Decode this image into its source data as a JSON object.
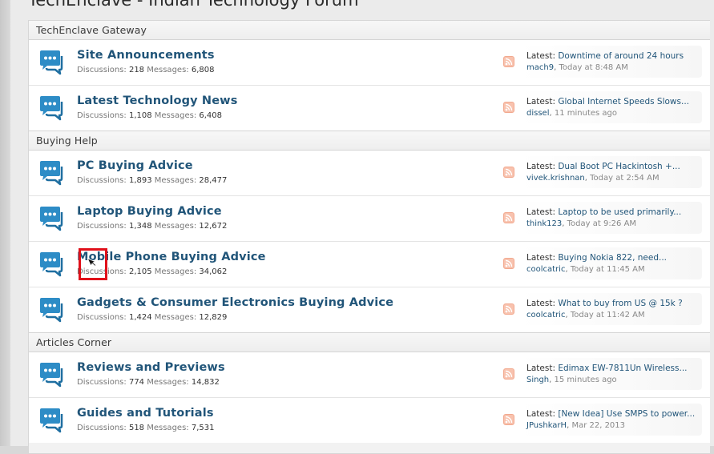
{
  "page": {
    "title": "TechEnclave - Indian Technology Forum"
  },
  "labels": {
    "discussions": "Discussions:",
    "messages": "Messages:",
    "latest": "Latest:"
  },
  "icons": {
    "forum": "forum-speech-bubble-icon",
    "rss": "rss-feed-icon",
    "cursor": "mouse-pointer-icon"
  },
  "colors": {
    "link": "#215579",
    "icon_blue": "#2d8cc6",
    "rss_orange": "#f6b09a",
    "highlight_red": "#e0101a"
  },
  "categories": [
    {
      "title": "TechEnclave Gateway",
      "nodes": [
        {
          "title": "Site Announcements",
          "discussions": "218",
          "messages": "6,808",
          "latest_title": "Downtime of around 24 hours",
          "latest_user": "mach9",
          "latest_time": "Today at 8:48 AM"
        },
        {
          "title": "Latest Technology News",
          "discussions": "1,108",
          "messages": "6,408",
          "latest_title": "Global Internet Speeds Slows...",
          "latest_user": "dissel",
          "latest_time": "11 minutes ago"
        }
      ]
    },
    {
      "title": "Buying Help",
      "nodes": [
        {
          "title": "PC Buying Advice",
          "discussions": "1,893",
          "messages": "28,477",
          "latest_title": "Dual Boot PC Hackintosh +...",
          "latest_user": "vivek.krishnan",
          "latest_time": "Today at 2:54 AM"
        },
        {
          "title": "Laptop Buying Advice",
          "discussions": "1,348",
          "messages": "12,672",
          "latest_title": "Laptop to be used primarily...",
          "latest_user": "think123",
          "latest_time": "Today at 9:26 AM"
        },
        {
          "title": "Mobile Phone Buying Advice",
          "discussions": "2,105",
          "messages": "34,062",
          "latest_title": "Buying Nokia 822, need...",
          "latest_user": "coolcatric",
          "latest_time": "Today at 11:45 AM"
        },
        {
          "title": "Gadgets & Consumer Electronics Buying Advice",
          "discussions": "1,424",
          "messages": "12,829",
          "latest_title": "What to buy from US @ 15k ?",
          "latest_user": "coolcatric",
          "latest_time": "Today at 11:42 AM"
        }
      ]
    },
    {
      "title": "Articles Corner",
      "nodes": [
        {
          "title": "Reviews and Previews",
          "discussions": "774",
          "messages": "14,832",
          "latest_title": "Edimax EW-7811Un Wireless...",
          "latest_user": "Singh",
          "latest_time": "15 minutes ago"
        },
        {
          "title": "Guides and Tutorials",
          "discussions": "518",
          "messages": "7,531",
          "latest_title": "[New Idea] Use SMPS to power...",
          "latest_user": "JPushkarH",
          "latest_time": "Mar 22, 2013"
        }
      ]
    }
  ]
}
